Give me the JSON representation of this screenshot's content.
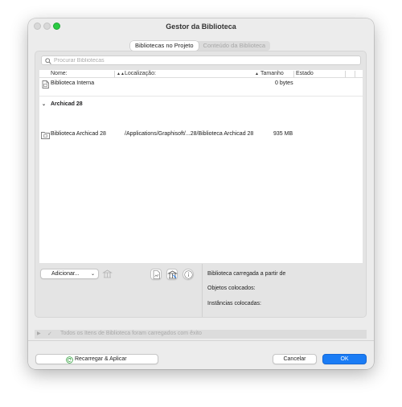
{
  "window": {
    "title": "Gestor da Biblioteca"
  },
  "tabs": [
    {
      "label": "Bibliotecas no Projeto",
      "active": true
    },
    {
      "label": "Conteúdo da Biblioteca",
      "active": false
    }
  ],
  "search": {
    "placeholder": "Procurar Bibliotecas",
    "value": ""
  },
  "columns": {
    "name": "Nome:",
    "location": "Localização:",
    "size": "Tamanho",
    "status": "Estado"
  },
  "rows": [
    {
      "name": "Biblioteca Interna",
      "location": "",
      "size": "0 bytes",
      "icon": "document-library-icon"
    },
    {
      "name": "Biblioteca Archicad 28",
      "location": "/Applications/Graphisoft/...28/Biblioteca Archicad 28",
      "size": "935 MB",
      "icon": "folder-library-icon"
    }
  ],
  "group": {
    "label": "Archicad 28"
  },
  "toolbar": {
    "add_label": "Adicionar..."
  },
  "info": {
    "loaded_from": "Biblioteca carregada a partir de",
    "objects": "Objetos colocados:",
    "instances": "Instâncias colocadas:"
  },
  "status": {
    "message": "Todos os Itens de Biblioteca foram carregados com êxito"
  },
  "footer": {
    "reload_label": "Recarregar & Aplicar",
    "cancel_label": "Cancelar",
    "ok_label": "OK"
  },
  "colors": {
    "accent": "#1a7cf5",
    "traffic_green": "#2acb42",
    "reload_icon": "#2e9d3a"
  }
}
